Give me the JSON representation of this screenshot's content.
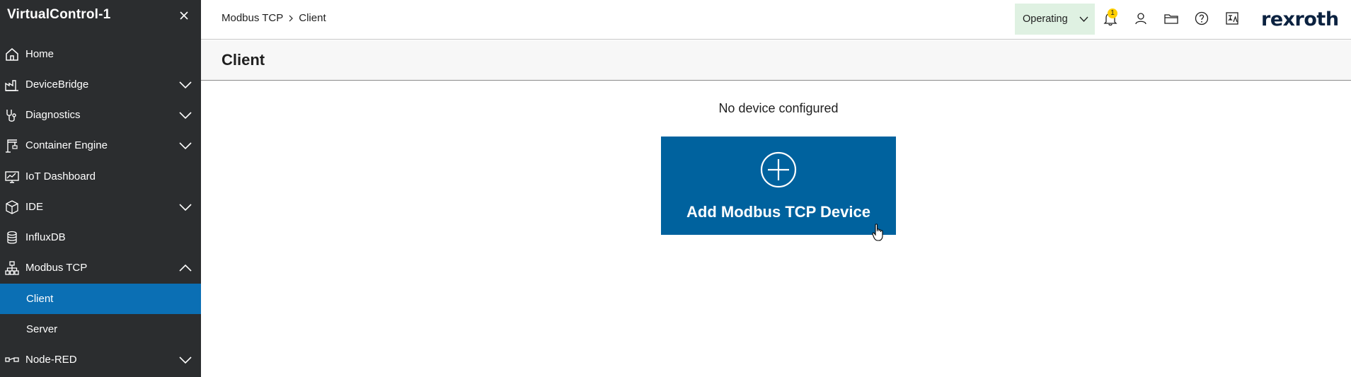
{
  "sidebar": {
    "title": "VirtualControl-1",
    "close_icon": "close-icon",
    "items": [
      {
        "label": "Home",
        "icon": "home-icon"
      },
      {
        "label": "DeviceBridge",
        "icon": "factory-icon"
      },
      {
        "label": "Diagnostics",
        "icon": "stethoscope-icon"
      },
      {
        "label": "Container Engine",
        "icon": "crane-icon"
      },
      {
        "label": "IoT Dashboard",
        "icon": "monitor-chart-icon"
      },
      {
        "label": "IDE",
        "icon": "box-icon"
      },
      {
        "label": "InfluxDB",
        "icon": "database-icon"
      },
      {
        "label": "Modbus TCP",
        "icon": "network-tree-icon"
      },
      {
        "label": "Client"
      },
      {
        "label": "Server"
      },
      {
        "label": "Node-RED",
        "icon": "node-icon"
      }
    ]
  },
  "header": {
    "breadcrumb": [
      "Modbus TCP",
      "Client"
    ],
    "status_label": "Operating",
    "notification_count": "1",
    "brand": "rexroth"
  },
  "page": {
    "title": "Client",
    "empty_message": "No device configured",
    "add_button_label": "Add Modbus TCP Device"
  },
  "colors": {
    "sidebar_bg": "#2b2d2f",
    "active_item": "#0b6fb4",
    "primary_button": "#00629e",
    "status_bg": "#dff1e2",
    "badge": "#ffcf00"
  }
}
